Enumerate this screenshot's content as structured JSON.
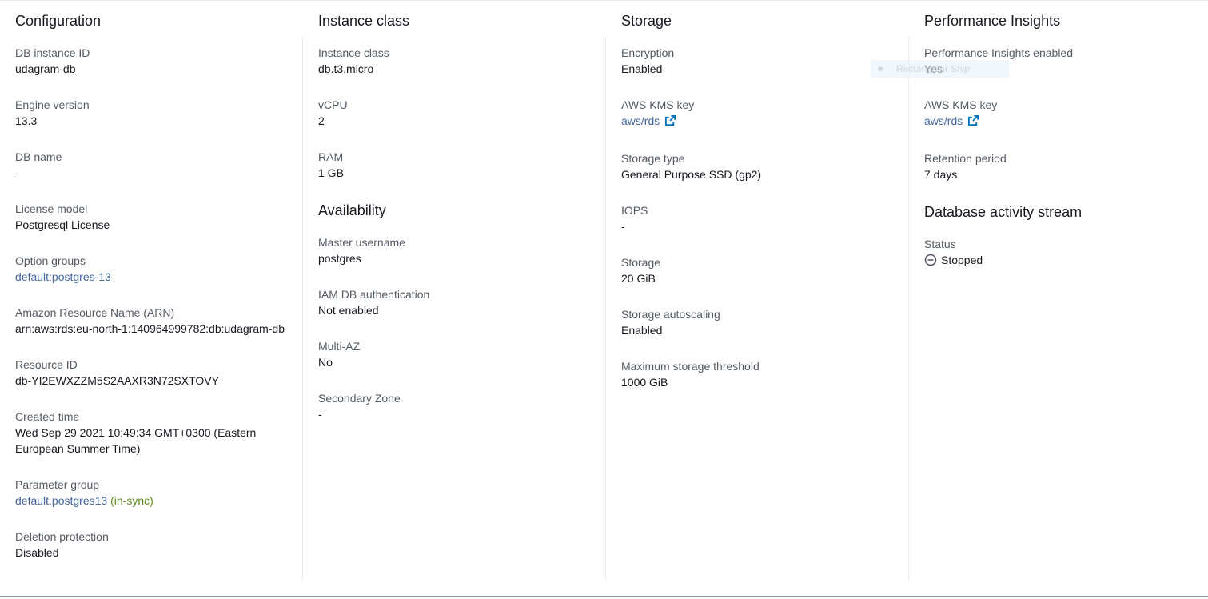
{
  "columns": [
    {
      "sections": [
        {
          "title": "Configuration",
          "fields": [
            {
              "label": "DB instance ID",
              "value": "udagram-db"
            },
            {
              "label": "Engine version",
              "value": "13.3"
            },
            {
              "label": "DB name",
              "value": "-"
            },
            {
              "label": "License model",
              "value": "Postgresql License"
            },
            {
              "label": "Option groups",
              "value": "default:postgres-13",
              "link": true
            },
            {
              "label": "Amazon Resource Name (ARN)",
              "value": "arn:aws:rds:eu-north-1:140964999782:db:udagram-db"
            },
            {
              "label": "Resource ID",
              "value": "db-YI2EWXZZM5S2AAXR3N72SXTOVY"
            },
            {
              "label": "Created time",
              "value": "Wed Sep 29 2021 10:49:34 GMT+0300 (Eastern European Summer Time)",
              "wrap": true
            },
            {
              "label": "Parameter group",
              "value": "default.postgres13",
              "link": true,
              "status": "(in-sync)"
            },
            {
              "label": "Deletion protection",
              "value": "Disabled"
            }
          ]
        }
      ]
    },
    {
      "sections": [
        {
          "title": "Instance class",
          "fields": [
            {
              "label": "Instance class",
              "value": "db.t3.micro"
            },
            {
              "label": "vCPU",
              "value": "2"
            },
            {
              "label": "RAM",
              "value": "1 GB"
            }
          ]
        },
        {
          "title": "Availability",
          "fields": [
            {
              "label": "Master username",
              "value": "postgres"
            },
            {
              "label": "IAM DB authentication",
              "value": "Not enabled"
            },
            {
              "label": "Multi-AZ",
              "value": "No"
            },
            {
              "label": "Secondary Zone",
              "value": "-"
            }
          ]
        }
      ]
    },
    {
      "sections": [
        {
          "title": "Storage",
          "fields": [
            {
              "label": "Encryption",
              "value": "Enabled"
            },
            {
              "label": "AWS KMS key",
              "value": "aws/rds",
              "link": true,
              "external": true
            },
            {
              "label": "Storage type",
              "value": "General Purpose SSD (gp2)"
            },
            {
              "label": "IOPS",
              "value": "-"
            },
            {
              "label": "Storage",
              "value": "20 GiB"
            },
            {
              "label": "Storage autoscaling",
              "value": "Enabled"
            },
            {
              "label": "Maximum storage threshold",
              "value": "1000 GiB"
            }
          ]
        }
      ]
    },
    {
      "sections": [
        {
          "title": "Performance Insights",
          "fields": [
            {
              "label": "Performance Insights enabled",
              "value": "Yes"
            },
            {
              "label": "AWS KMS key",
              "value": "aws/rds",
              "link": true,
              "external": true
            },
            {
              "label": "Retention period",
              "value": "7 days"
            }
          ]
        },
        {
          "title": "Database activity stream",
          "fields": [
            {
              "label": "Status",
              "value": "Stopped",
              "icon": "stopped-circle-icon"
            }
          ]
        }
      ]
    }
  ],
  "overlay": {
    "snip_label": "Rectangular Snip"
  },
  "colors": {
    "link": "#44679e",
    "success": "#5a8a1e",
    "label": "#545b64",
    "text": "#16191f"
  }
}
